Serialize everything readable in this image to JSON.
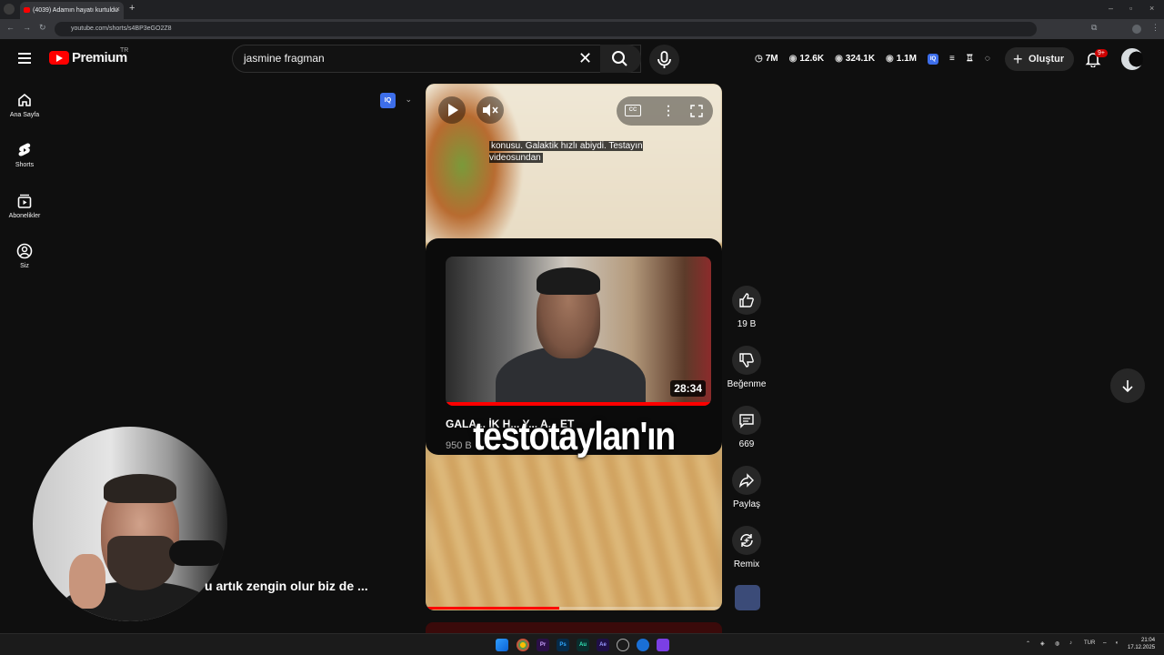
{
  "browser": {
    "tab_title": "(4039) Adamın hayatı kurtuldu",
    "url": "youtube.com/shorts/s4BP3eGO2Z8"
  },
  "header": {
    "logo_text": "Premium",
    "country": "TR",
    "search_value": "jasmine fragman",
    "stats": [
      "7M",
      "12.6K",
      "324.1K",
      "1.1M"
    ],
    "iq_label": "IQ",
    "create_label": "Oluştur",
    "notification_count": "9+"
  },
  "sidebar": {
    "items": [
      {
        "label": "Ana Sayfa",
        "icon": "home-icon"
      },
      {
        "label": "Shorts",
        "icon": "shorts-icon"
      },
      {
        "label": "Abonelikler",
        "icon": "subscriptions-icon"
      },
      {
        "label": "Siz",
        "icon": "you-icon"
      }
    ]
  },
  "player": {
    "iq_label": "IQ",
    "caption": "konusu. Galaktik hızlı abiydi. Testayın videosundan",
    "cc_label": "CC",
    "card_title": "GALA... İK H... Y... A... ET",
    "card_views": "950 B",
    "duration": "28:34",
    "burned_subtitle": "testotaylan'ın",
    "progress_fraction": 0.45
  },
  "actions": {
    "like_count": "19 B",
    "dislike_label": "Beğenme",
    "comment_count": "669",
    "share_label": "Paylaş",
    "remix_label": "Remix"
  },
  "overlay": {
    "lower_text": "u artık zengin olur biz de ..."
  },
  "taskbar": {
    "apps": [
      "Pr",
      "Ps",
      "Au",
      "Ae"
    ],
    "lang": "TUR",
    "time": "21:04",
    "date": "17.12.2025"
  },
  "colors": {
    "accent": "#ff0000",
    "background": "#0f0f0f",
    "iq_blue": "#3d6eea"
  }
}
